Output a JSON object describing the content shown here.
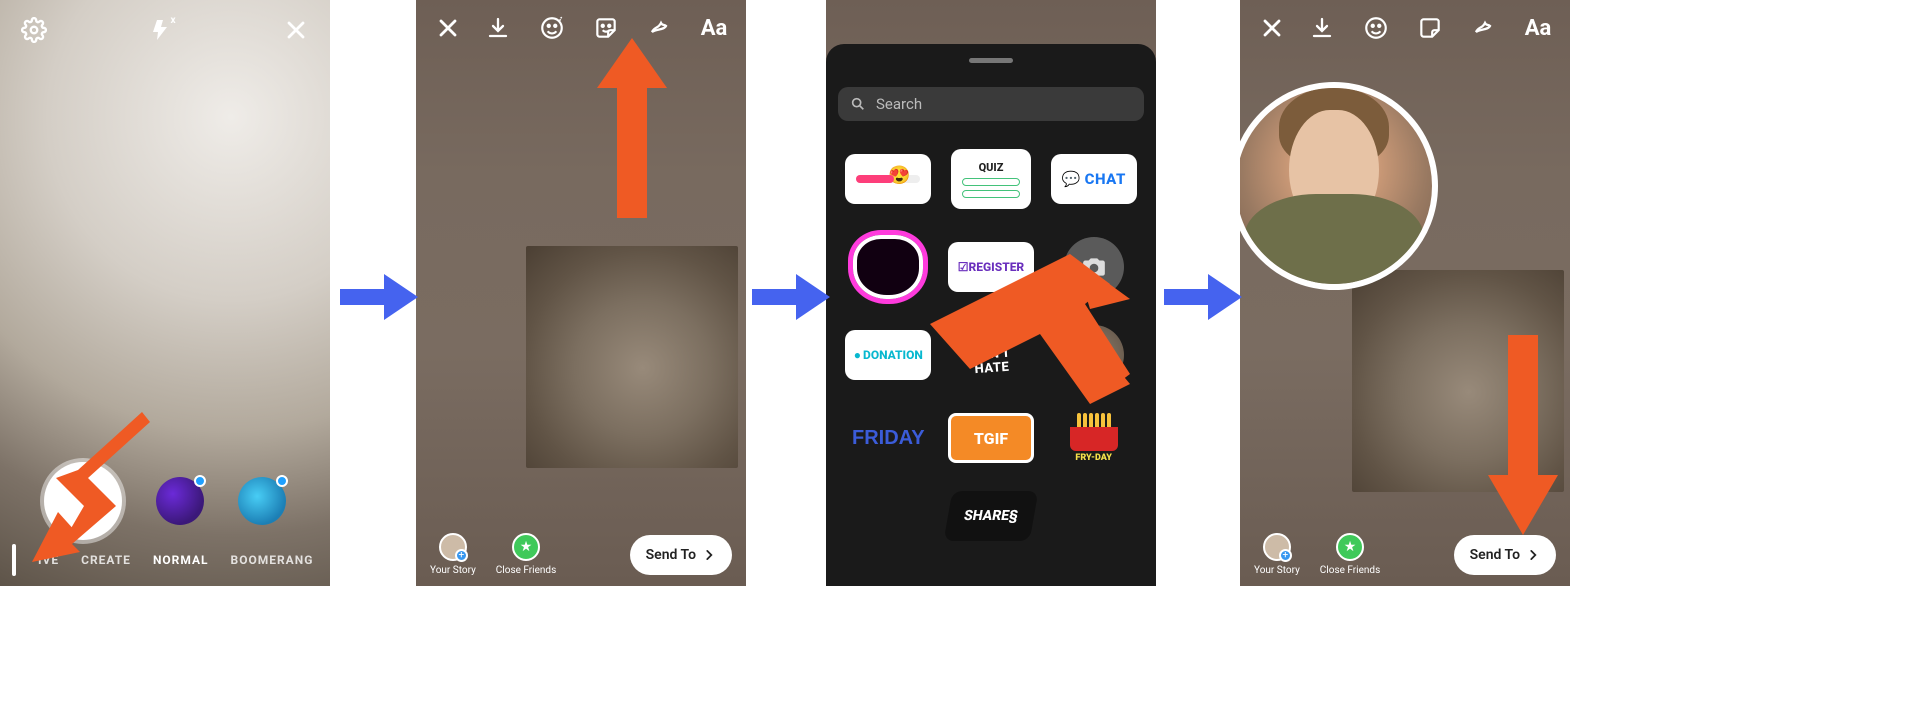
{
  "screen1": {
    "modes": {
      "live": "IVE",
      "create": "CREATE",
      "normal": "NORMAL",
      "boomerang": "BOOMERANG"
    }
  },
  "editor": {
    "text_tool": "Aa",
    "your_story": "Your Story",
    "close_friends": "Close Friends",
    "send_to": "Send To"
  },
  "picker": {
    "search_placeholder": "Search",
    "quiz": "QUIZ",
    "chat": "CHAT",
    "register": "☑REGISTER",
    "donation": "DONATION",
    "create_dont_hate": "CREATE\nDON'T\nHATE",
    "friday": "FRIDAY",
    "tgif": "TGIF",
    "fryday": "FRY-DAY",
    "shares": "SHARE§"
  },
  "colors": {
    "arrow_orange": "#ef5a24",
    "arrow_blue": "#4563ef"
  }
}
